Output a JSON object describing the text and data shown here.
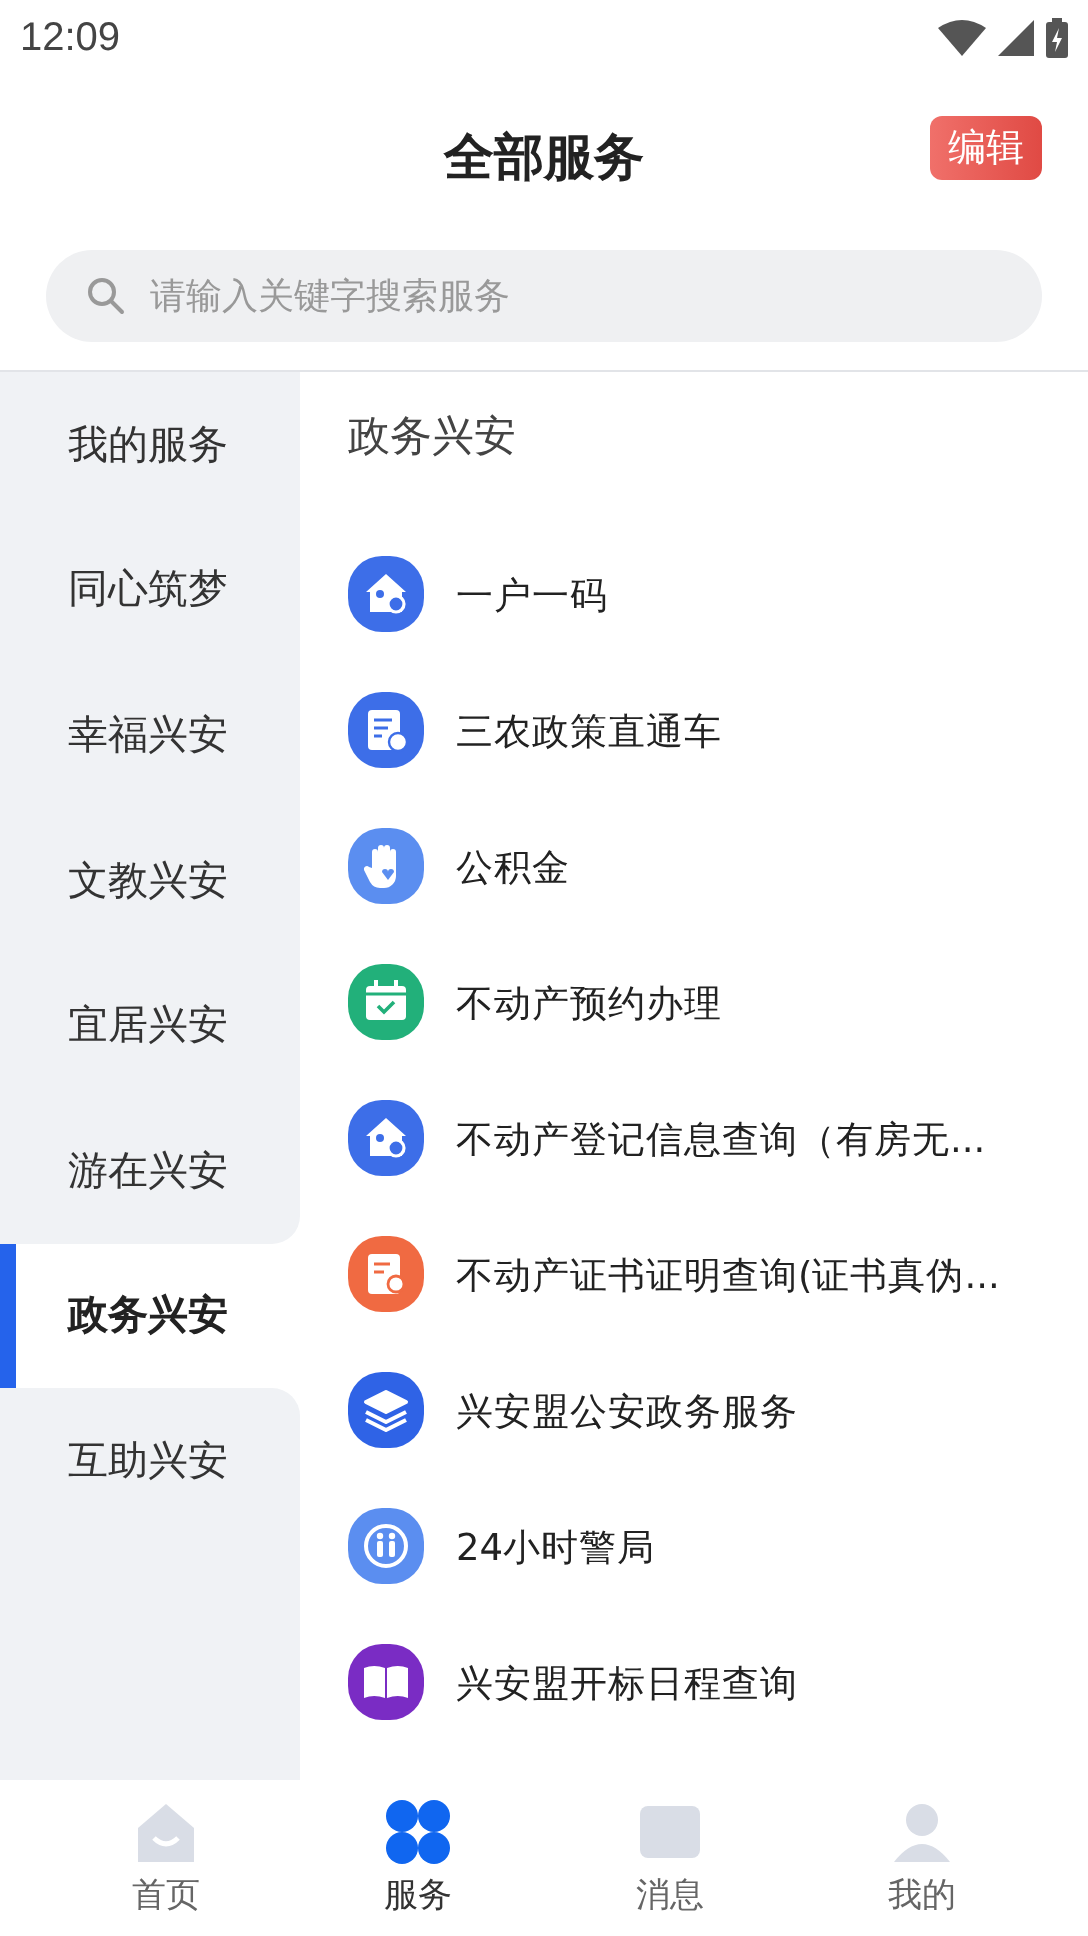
{
  "status_bar": {
    "time": "12:09"
  },
  "header": {
    "title": "全部服务",
    "edit_button": "编辑"
  },
  "search": {
    "placeholder": "请输入关键字搜索服务"
  },
  "sidebar": {
    "items": [
      {
        "label": "我的服务",
        "selected": false
      },
      {
        "label": "同心筑梦",
        "selected": false
      },
      {
        "label": "幸福兴安",
        "selected": false
      },
      {
        "label": "文教兴安",
        "selected": false
      },
      {
        "label": "宜居兴安",
        "selected": false
      },
      {
        "label": "游在兴安",
        "selected": false
      },
      {
        "label": "政务兴安",
        "selected": true
      },
      {
        "label": "互助兴安",
        "selected": false
      }
    ]
  },
  "section": {
    "title": "政务兴安",
    "services": [
      {
        "label": "一户一码",
        "kind": "house",
        "color": "#3d6ee8"
      },
      {
        "label": "三农政策直通车",
        "kind": "document",
        "color": "#3d6ee8"
      },
      {
        "label": "公积金",
        "kind": "hand",
        "color": "#5b8ef0"
      },
      {
        "label": "不动产预约办理",
        "kind": "calendar",
        "color": "#22b07a"
      },
      {
        "label": "不动产登记信息查询（有房无...",
        "kind": "house",
        "color": "#3d6ee8"
      },
      {
        "label": "不动产证书证明查询(证书真伪...",
        "kind": "certificate",
        "color": "#f06a42"
      },
      {
        "label": "兴安盟公安政务服务",
        "kind": "layers",
        "color": "#2f63e6"
      },
      {
        "label": "24小时警局",
        "kind": "people",
        "color": "#5b8ef0"
      },
      {
        "label": "兴安盟开标日程查询",
        "kind": "book",
        "color": "#7a2cc4"
      }
    ]
  },
  "bottom_nav": [
    {
      "label": "首页",
      "kind": "home",
      "selected": false
    },
    {
      "label": "服务",
      "kind": "services",
      "selected": true
    },
    {
      "label": "消息",
      "kind": "message",
      "selected": false
    },
    {
      "label": "我的",
      "kind": "profile",
      "selected": false
    }
  ]
}
